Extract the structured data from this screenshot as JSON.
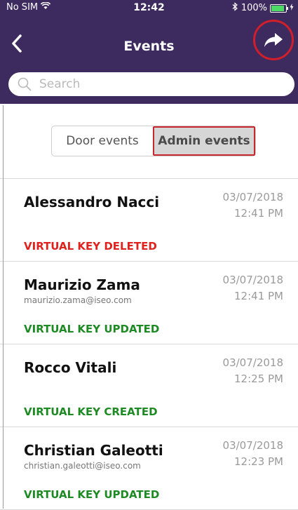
{
  "status_bar": {
    "carrier": "No SIM",
    "time": "12:42",
    "battery": "100%",
    "battery_level": 1.0
  },
  "nav": {
    "title": "Events"
  },
  "search": {
    "placeholder": "Search"
  },
  "segments": {
    "door_label": "Door events",
    "admin_label": "Admin events",
    "selected": "admin"
  },
  "colors": {
    "header_bg": "#3d2b60",
    "deleted": "#e0221e",
    "updated": "#1d8a23",
    "created": "#1d8a23",
    "highlight": "#c8262e"
  },
  "events": [
    {
      "name": "Alessandro Nacci",
      "email": "",
      "date": "03/07/2018",
      "time": "12:41 PM",
      "status": "VIRTUAL KEY DELETED",
      "status_type": "deleted"
    },
    {
      "name": "Maurizio Zama",
      "email": "maurizio.zama@iseo.com",
      "date": "03/07/2018",
      "time": "12:41 PM",
      "status": "VIRTUAL KEY UPDATED",
      "status_type": "updated"
    },
    {
      "name": "Rocco Vitali",
      "email": "",
      "date": "03/07/2018",
      "time": "12:25 PM",
      "status": "VIRTUAL KEY CREATED",
      "status_type": "created"
    },
    {
      "name": "Christian Galeotti",
      "email": "christian.galeotti@iseo.com",
      "date": "03/07/2018",
      "time": "12:23 PM",
      "status": "VIRTUAL KEY UPDATED",
      "status_type": "updated"
    }
  ]
}
